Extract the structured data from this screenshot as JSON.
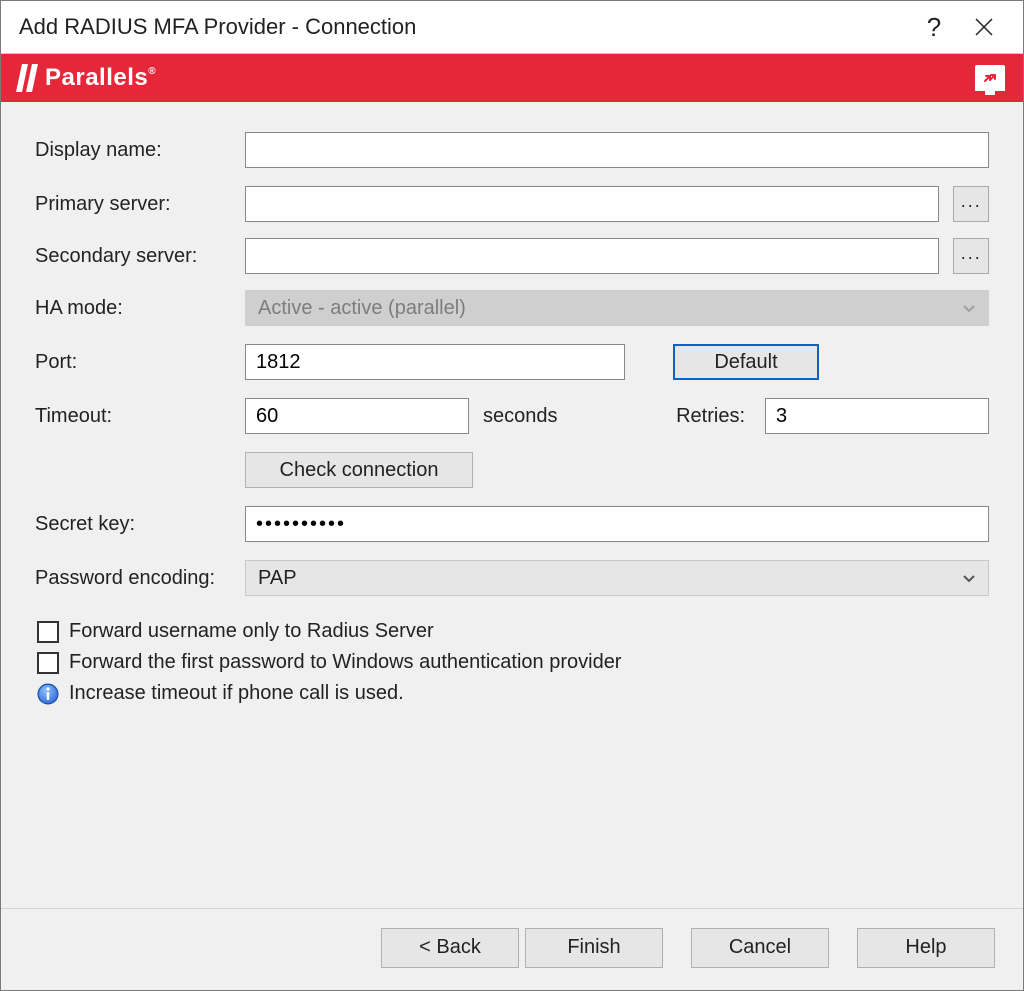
{
  "window": {
    "title": "Add RADIUS MFA Provider - Connection",
    "help_symbol": "?"
  },
  "brand": {
    "name": "Parallels",
    "registered": "®"
  },
  "form": {
    "display_name": {
      "label": "Display name:",
      "value": ""
    },
    "primary_server": {
      "label": "Primary server:",
      "value": "",
      "browse": "..."
    },
    "secondary_server": {
      "label": "Secondary server:",
      "value": "",
      "browse": "..."
    },
    "ha_mode": {
      "label": "HA mode:",
      "value": "Active - active (parallel)"
    },
    "port": {
      "label": "Port:",
      "value": "1812",
      "default_btn": "Default"
    },
    "timeout": {
      "label": "Timeout:",
      "value": "60",
      "unit": "seconds"
    },
    "retries": {
      "label": "Retries:",
      "value": "3"
    },
    "check_connection": "Check connection",
    "secret_key": {
      "label": "Secret key:",
      "value": "••••••••••"
    },
    "password_encoding": {
      "label": "Password encoding:",
      "value": "PAP"
    },
    "forward_username": "Forward username only to Radius Server",
    "forward_first_password": "Forward the first password to Windows authentication provider",
    "info_text": "Increase timeout if phone call is used."
  },
  "footer": {
    "back": "< Back",
    "finish": "Finish",
    "cancel": "Cancel",
    "help": "Help"
  }
}
